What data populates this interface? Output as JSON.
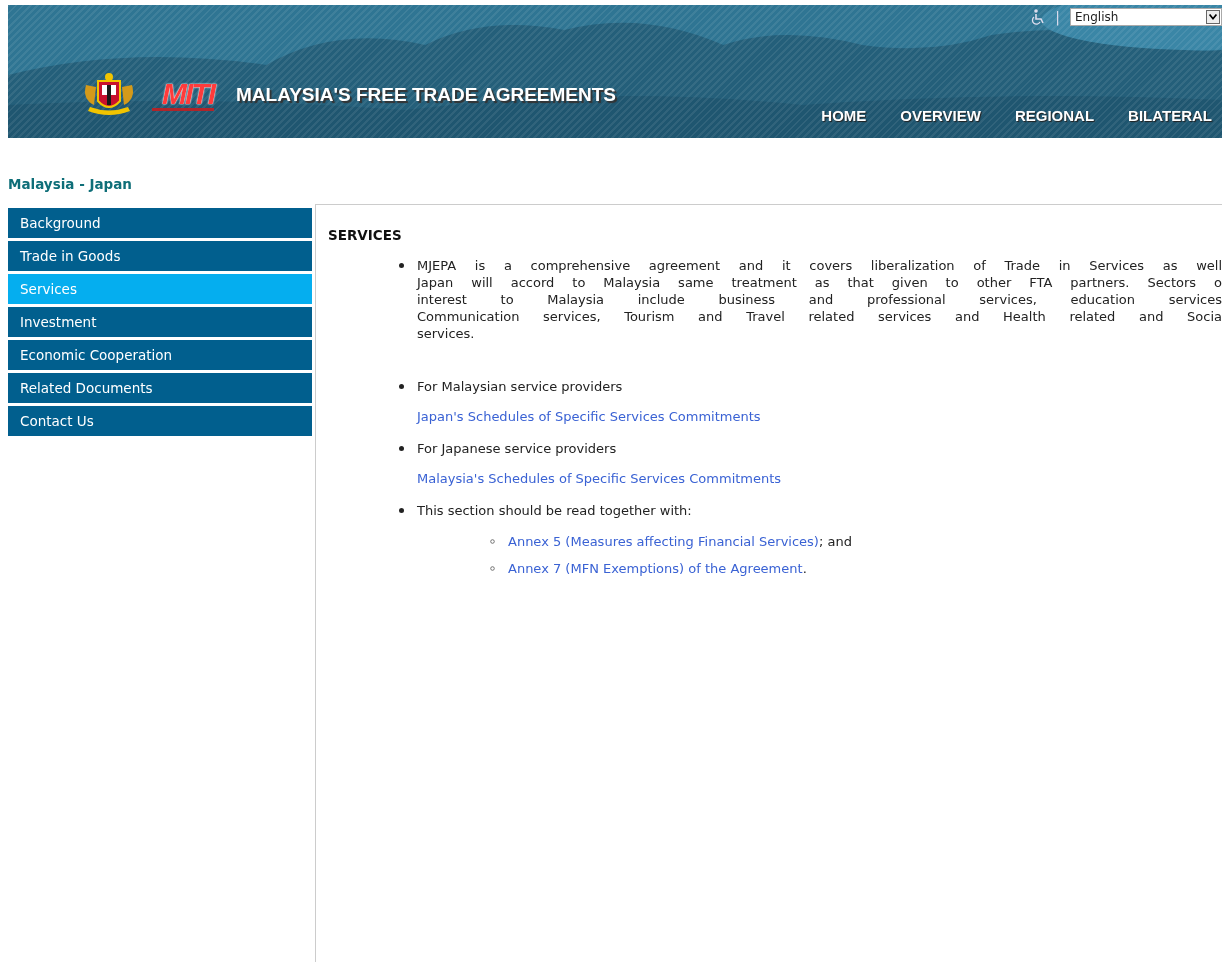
{
  "header": {
    "logo_text": "MITI",
    "title": "MALAYSIA'S FREE TRADE AGREEMENTS",
    "separator": "|",
    "language": {
      "value": "English"
    },
    "nav": [
      {
        "label": "HOME"
      },
      {
        "label": "OVERVIEW"
      },
      {
        "label": "REGIONAL"
      },
      {
        "label": "BILATERAL"
      }
    ]
  },
  "page_title": "Malaysia - Japan",
  "sidebar": {
    "items": [
      {
        "label": "Background",
        "selected": false
      },
      {
        "label": "Trade in Goods",
        "selected": false
      },
      {
        "label": "Services",
        "selected": true
      },
      {
        "label": "Investment",
        "selected": false
      },
      {
        "label": "Economic Cooperation",
        "selected": false
      },
      {
        "label": "Related Documents",
        "selected": false
      },
      {
        "label": "Contact Us",
        "selected": false
      }
    ]
  },
  "content": {
    "heading": "SERVICES",
    "intro_lines": [
      "MJEPA is a comprehensive agreement and it covers liberalization of Trade in Services as well",
      "Japan will accord to Malaysia same treatment as that given to other FTA partners. Sectors o",
      "interest to Malaysia include business and professional services, education services",
      "Communication services, Tourism and Travel related services and Health related and Socia",
      "services."
    ],
    "items": [
      {
        "text": "For Malaysian service providers",
        "link": "Japan's Schedules of Specific Services Commitments"
      },
      {
        "text": "For Japanese service providers",
        "link": "Malaysia's Schedules of Specific Services Commitments"
      },
      {
        "text": "This section should be read together with:",
        "subitems": [
          {
            "link": "Annex 5 (Measures affecting Financial Services)",
            "after": "; and"
          },
          {
            "link": "Annex 7 (MFN Exemptions) of the Agreement",
            "after": "."
          }
        ]
      }
    ]
  }
}
